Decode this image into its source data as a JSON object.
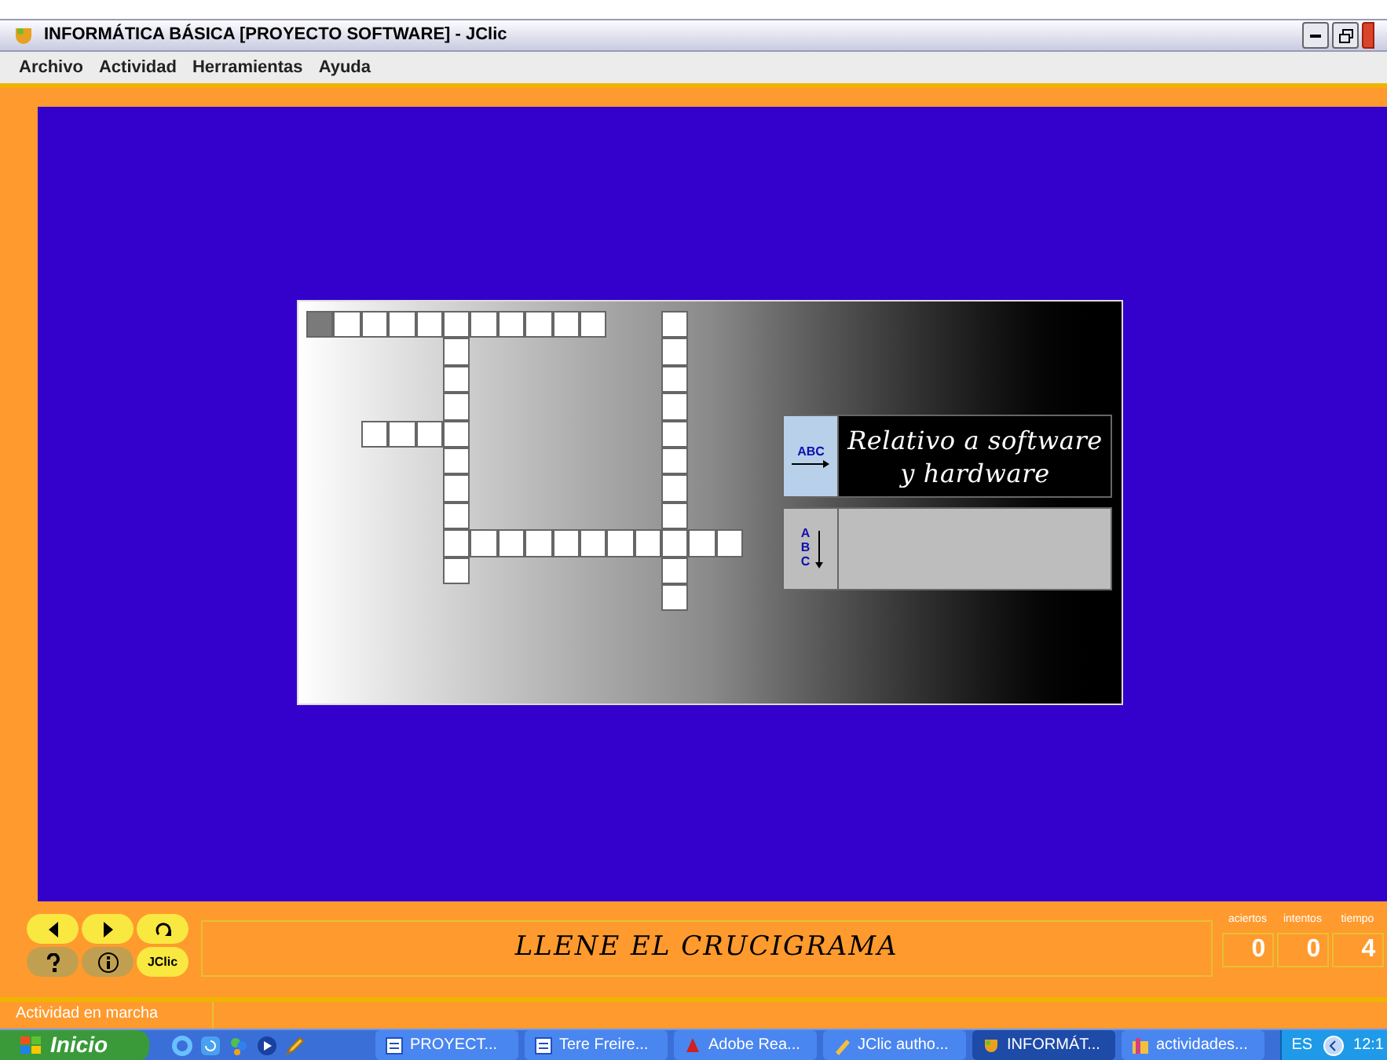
{
  "window": {
    "title": "INFORMÁTICA BÁSICA [PROYECTO SOFTWARE] - JClic"
  },
  "menu": [
    {
      "label": "Archivo"
    },
    {
      "label": "Actividad"
    },
    {
      "label": "Herramientas"
    },
    {
      "label": "Ayuda"
    }
  ],
  "crossword": {
    "rows": [
      {
        "cells": [
          {
            "kind": "box",
            "selected": true
          },
          {
            "kind": "box",
            "selected": false
          },
          {
            "kind": "box",
            "selected": false
          },
          {
            "kind": "box",
            "selected": false
          },
          {
            "kind": "box",
            "selected": false
          },
          {
            "kind": "box",
            "selected": false
          },
          {
            "kind": "box",
            "selected": false
          },
          {
            "kind": "box",
            "selected": false
          },
          {
            "kind": "box",
            "selected": false
          },
          {
            "kind": "box",
            "selected": false
          },
          {
            "kind": "box",
            "selected": false
          },
          {
            "kind": "gap"
          },
          {
            "kind": "gap"
          },
          {
            "kind": "box",
            "selected": false
          },
          {
            "kind": "gap"
          },
          {
            "kind": "gap"
          }
        ]
      },
      {
        "cells": [
          {
            "kind": "gap"
          },
          {
            "kind": "gap"
          },
          {
            "kind": "gap"
          },
          {
            "kind": "gap"
          },
          {
            "kind": "gap"
          },
          {
            "kind": "box",
            "selected": false
          },
          {
            "kind": "gap"
          },
          {
            "kind": "gap"
          },
          {
            "kind": "gap"
          },
          {
            "kind": "gap"
          },
          {
            "kind": "gap"
          },
          {
            "kind": "gap"
          },
          {
            "kind": "gap"
          },
          {
            "kind": "box",
            "selected": false
          },
          {
            "kind": "gap"
          },
          {
            "kind": "gap"
          }
        ]
      },
      {
        "cells": [
          {
            "kind": "gap"
          },
          {
            "kind": "gap"
          },
          {
            "kind": "gap"
          },
          {
            "kind": "gap"
          },
          {
            "kind": "gap"
          },
          {
            "kind": "box",
            "selected": false
          },
          {
            "kind": "gap"
          },
          {
            "kind": "gap"
          },
          {
            "kind": "gap"
          },
          {
            "kind": "gap"
          },
          {
            "kind": "gap"
          },
          {
            "kind": "gap"
          },
          {
            "kind": "gap"
          },
          {
            "kind": "box",
            "selected": false
          },
          {
            "kind": "gap"
          },
          {
            "kind": "gap"
          }
        ]
      },
      {
        "cells": [
          {
            "kind": "gap"
          },
          {
            "kind": "gap"
          },
          {
            "kind": "gap"
          },
          {
            "kind": "gap"
          },
          {
            "kind": "gap"
          },
          {
            "kind": "box",
            "selected": false
          },
          {
            "kind": "gap"
          },
          {
            "kind": "gap"
          },
          {
            "kind": "gap"
          },
          {
            "kind": "gap"
          },
          {
            "kind": "gap"
          },
          {
            "kind": "gap"
          },
          {
            "kind": "gap"
          },
          {
            "kind": "box",
            "selected": false
          },
          {
            "kind": "gap"
          },
          {
            "kind": "gap"
          }
        ]
      },
      {
        "cells": [
          {
            "kind": "gap"
          },
          {
            "kind": "gap"
          },
          {
            "kind": "box",
            "selected": false
          },
          {
            "kind": "box",
            "selected": false
          },
          {
            "kind": "box",
            "selected": false
          },
          {
            "kind": "box",
            "selected": false
          },
          {
            "kind": "gap"
          },
          {
            "kind": "gap"
          },
          {
            "kind": "gap"
          },
          {
            "kind": "gap"
          },
          {
            "kind": "gap"
          },
          {
            "kind": "gap"
          },
          {
            "kind": "gap"
          },
          {
            "kind": "box",
            "selected": false
          },
          {
            "kind": "gap"
          },
          {
            "kind": "gap"
          }
        ]
      },
      {
        "cells": [
          {
            "kind": "gap"
          },
          {
            "kind": "gap"
          },
          {
            "kind": "gap"
          },
          {
            "kind": "gap"
          },
          {
            "kind": "gap"
          },
          {
            "kind": "box",
            "selected": false
          },
          {
            "kind": "gap"
          },
          {
            "kind": "gap"
          },
          {
            "kind": "gap"
          },
          {
            "kind": "gap"
          },
          {
            "kind": "gap"
          },
          {
            "kind": "gap"
          },
          {
            "kind": "gap"
          },
          {
            "kind": "box",
            "selected": false
          },
          {
            "kind": "gap"
          },
          {
            "kind": "gap"
          }
        ]
      },
      {
        "cells": [
          {
            "kind": "gap"
          },
          {
            "kind": "gap"
          },
          {
            "kind": "gap"
          },
          {
            "kind": "gap"
          },
          {
            "kind": "gap"
          },
          {
            "kind": "box",
            "selected": false
          },
          {
            "kind": "gap"
          },
          {
            "kind": "gap"
          },
          {
            "kind": "gap"
          },
          {
            "kind": "gap"
          },
          {
            "kind": "gap"
          },
          {
            "kind": "gap"
          },
          {
            "kind": "gap"
          },
          {
            "kind": "box",
            "selected": false
          },
          {
            "kind": "gap"
          },
          {
            "kind": "gap"
          }
        ]
      },
      {
        "cells": [
          {
            "kind": "gap"
          },
          {
            "kind": "gap"
          },
          {
            "kind": "gap"
          },
          {
            "kind": "gap"
          },
          {
            "kind": "gap"
          },
          {
            "kind": "box",
            "selected": false
          },
          {
            "kind": "gap"
          },
          {
            "kind": "gap"
          },
          {
            "kind": "gap"
          },
          {
            "kind": "gap"
          },
          {
            "kind": "gap"
          },
          {
            "kind": "gap"
          },
          {
            "kind": "gap"
          },
          {
            "kind": "box",
            "selected": false
          },
          {
            "kind": "gap"
          },
          {
            "kind": "gap"
          }
        ]
      },
      {
        "cells": [
          {
            "kind": "gap"
          },
          {
            "kind": "gap"
          },
          {
            "kind": "gap"
          },
          {
            "kind": "gap"
          },
          {
            "kind": "gap"
          },
          {
            "kind": "box",
            "selected": false
          },
          {
            "kind": "box",
            "selected": false
          },
          {
            "kind": "box",
            "selected": false
          },
          {
            "kind": "box",
            "selected": false
          },
          {
            "kind": "box",
            "selected": false
          },
          {
            "kind": "box",
            "selected": false
          },
          {
            "kind": "box",
            "selected": false
          },
          {
            "kind": "box",
            "selected": false
          },
          {
            "kind": "box",
            "selected": false
          },
          {
            "kind": "box",
            "selected": false
          },
          {
            "kind": "box",
            "selected": false
          }
        ]
      },
      {
        "cells": [
          {
            "kind": "gap"
          },
          {
            "kind": "gap"
          },
          {
            "kind": "gap"
          },
          {
            "kind": "gap"
          },
          {
            "kind": "gap"
          },
          {
            "kind": "box",
            "selected": false
          },
          {
            "kind": "gap"
          },
          {
            "kind": "gap"
          },
          {
            "kind": "gap"
          },
          {
            "kind": "gap"
          },
          {
            "kind": "gap"
          },
          {
            "kind": "gap"
          },
          {
            "kind": "gap"
          },
          {
            "kind": "box",
            "selected": false
          },
          {
            "kind": "gap"
          },
          {
            "kind": "gap"
          }
        ]
      },
      {
        "cells": [
          {
            "kind": "gap"
          },
          {
            "kind": "gap"
          },
          {
            "kind": "gap"
          },
          {
            "kind": "gap"
          },
          {
            "kind": "gap"
          },
          {
            "kind": "gap"
          },
          {
            "kind": "gap"
          },
          {
            "kind": "gap"
          },
          {
            "kind": "gap"
          },
          {
            "kind": "gap"
          },
          {
            "kind": "gap"
          },
          {
            "kind": "gap"
          },
          {
            "kind": "gap"
          },
          {
            "kind": "box",
            "selected": false
          },
          {
            "kind": "gap"
          },
          {
            "kind": "gap"
          }
        ]
      }
    ]
  },
  "clues": [
    {
      "kind": "across",
      "selected": true,
      "icon_text": "ABC",
      "text": "Relativo a software y hardware"
    },
    {
      "kind": "down",
      "selected": false,
      "icon_text": "ABC"
    }
  ],
  "controls": [
    {
      "kind": "prev"
    },
    {
      "kind": "next"
    },
    {
      "kind": "restart"
    },
    {
      "kind": "help"
    },
    {
      "kind": "info"
    },
    {
      "kind": "jclic",
      "label": "JClic"
    }
  ],
  "message": "LLENE EL CRUCIGRAMA",
  "counters": [
    {
      "label": "aciertos",
      "value": "0"
    },
    {
      "label": "intentos",
      "value": "0"
    },
    {
      "label": "tiempo",
      "value": "4"
    }
  ],
  "status_bar": {
    "text": "Actividad en marcha"
  },
  "taskbar": {
    "start": "Inicio",
    "quick_launch": [
      {
        "kind": "ie"
      },
      {
        "kind": "refresh"
      },
      {
        "kind": "messenger"
      },
      {
        "kind": "media"
      },
      {
        "kind": "pen"
      }
    ],
    "tasks": [
      {
        "label": "PROYECT...",
        "kind": "word",
        "selected": false
      },
      {
        "label": "Tere Freire...",
        "kind": "word",
        "selected": false
      },
      {
        "label": "Adobe Rea...",
        "kind": "pdf",
        "selected": false
      },
      {
        "label": "JClic autho...",
        "kind": "author",
        "selected": false
      },
      {
        "label": "INFORMÁT...",
        "kind": "jclic",
        "selected": true
      },
      {
        "label": "actividades...",
        "kind": "folder",
        "selected": false
      }
    ],
    "language": "ES",
    "clock": "12:1"
  }
}
